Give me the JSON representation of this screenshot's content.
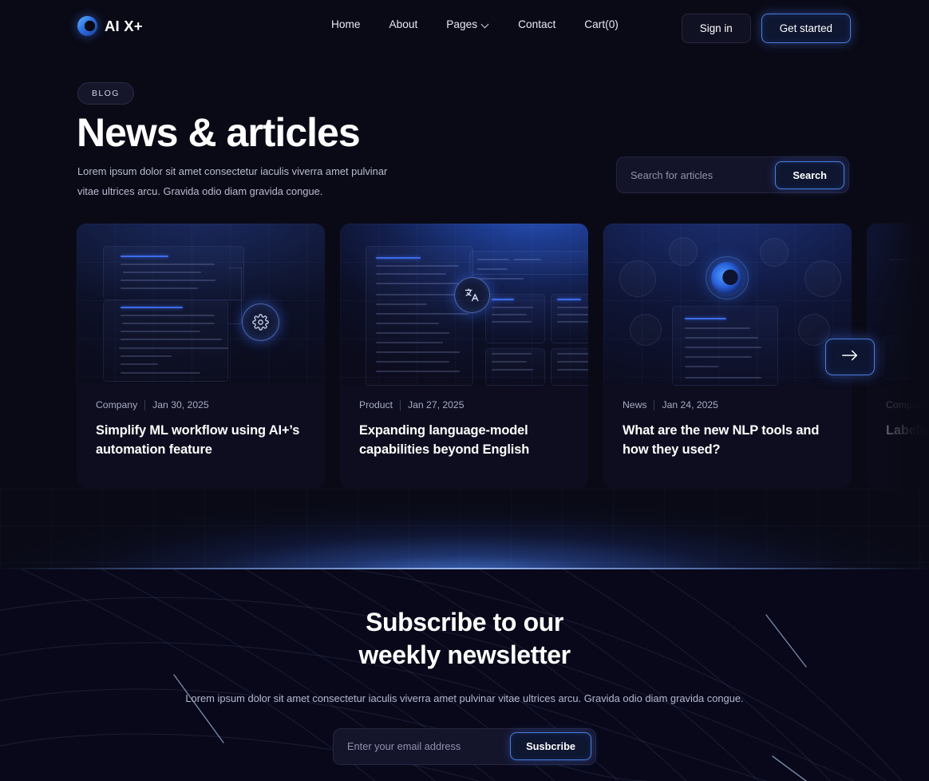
{
  "nav": {
    "brand": "AI X+",
    "brand_icon": "ring-logo-icon",
    "links": [
      {
        "label": "Home"
      },
      {
        "label": "About"
      },
      {
        "label": "Pages",
        "icon": "chevron-down-icon"
      },
      {
        "label": "Contact"
      },
      {
        "label": "Cart(0)"
      }
    ],
    "sign_in": "Sign in",
    "get_started": "Get started"
  },
  "hero": {
    "badge": "BLOG",
    "title": "News & articles",
    "subtitle": "Lorem ipsum dolor sit amet consectetur iaculis viverra amet pulvinar vitae ultrices arcu. Gravida odio diam gravida congue."
  },
  "search": {
    "placeholder": "Search for articles",
    "value": "",
    "button": "Search"
  },
  "cards": [
    {
      "category": "Company",
      "date": "Jan 30, 2025",
      "title": "Simplify ML workflow using AI+’s automation feature",
      "icon": "gear-icon"
    },
    {
      "category": "Product",
      "date": "Jan 27, 2025",
      "title": "Expanding language-model capabilities beyond English",
      "icon": "translate-icon"
    },
    {
      "category": "News",
      "date": "Jan 24, 2025",
      "title": "What are the new NLP tools and how they used?",
      "icon": "orb-icon"
    },
    {
      "category": "Company",
      "date": "",
      "title": "Labeling mode",
      "icon": "card-icon"
    }
  ],
  "carousel": {
    "next_label": "→",
    "next_icon": "arrow-right-icon"
  },
  "newsletter": {
    "title_line1": "Subscribe to our",
    "title_line2": "weekly newsletter",
    "subtitle": "Lorem ipsum dolor sit amet consectetur iaculis viverra amet pulvinar vitae ultrices arcu. Gravida odio diam gravida congue.",
    "placeholder": "Enter your email address",
    "value": "",
    "button": "Susbcribe"
  },
  "colors": {
    "background": "#0a0a16",
    "accent": "#4a7ddb",
    "accent_glow": "#3d6bef",
    "text": "#ffffff",
    "muted": "#b8bcd0"
  }
}
